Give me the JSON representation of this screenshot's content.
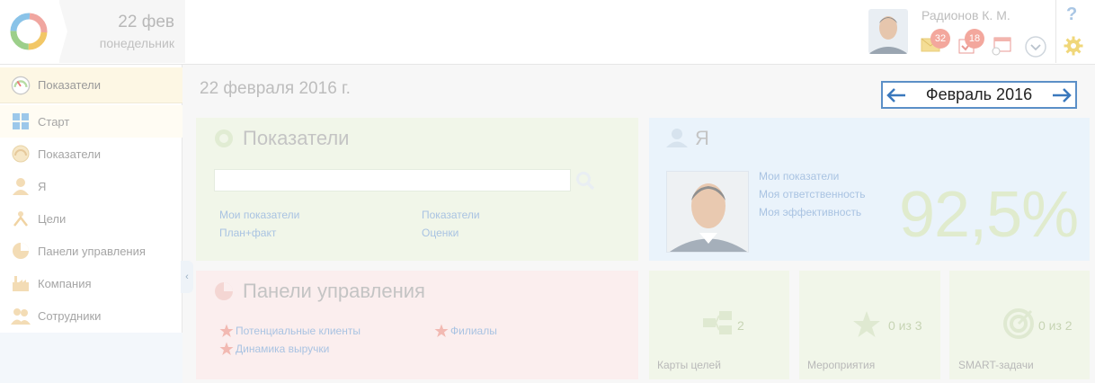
{
  "header": {
    "date_day": "22 фев",
    "date_weekday": "понедельник",
    "user_name": "Радионов К. М.",
    "messages_count": "32",
    "tasks_count": "18",
    "help_label": "?"
  },
  "sidebar": {
    "items": [
      {
        "label": "Показатели",
        "icon": "gauge-icon"
      },
      {
        "label": "Старт",
        "icon": "tiles-icon"
      },
      {
        "label": "Показатели",
        "icon": "gauge-icon"
      },
      {
        "label": "Я",
        "icon": "person-icon"
      },
      {
        "label": "Цели",
        "icon": "goal-icon"
      },
      {
        "label": "Панели управления",
        "icon": "pie-icon"
      },
      {
        "label": "Компания",
        "icon": "factory-icon"
      },
      {
        "label": "Сотрудники",
        "icon": "people-icon"
      }
    ],
    "collapse_label": "‹"
  },
  "main": {
    "page_date": "22 февраля 2016 г.",
    "month_label": "Февраль 2016"
  },
  "indicators": {
    "title": "Показатели",
    "links": [
      "Мои показатели",
      "Показатели",
      "План+факт",
      "Оценки"
    ]
  },
  "me": {
    "title": "Я",
    "links": [
      "Мои показатели",
      "Моя ответственность",
      "Моя эффективность"
    ],
    "efficiency": "92,5%"
  },
  "dashboards": {
    "title": "Панели управления",
    "links": [
      "Потенциальные клиенты",
      "Филиалы",
      "Динамика выручки"
    ]
  },
  "goal_maps": {
    "count": "2",
    "label": "Карты целей"
  },
  "events": {
    "count": "0 из 3",
    "label": "Мероприятия"
  },
  "smart": {
    "count": "0 из 2",
    "label": "SMART-задачи"
  },
  "colors": {
    "accent": "#5b8fc7",
    "badge": "#f3a79d"
  }
}
